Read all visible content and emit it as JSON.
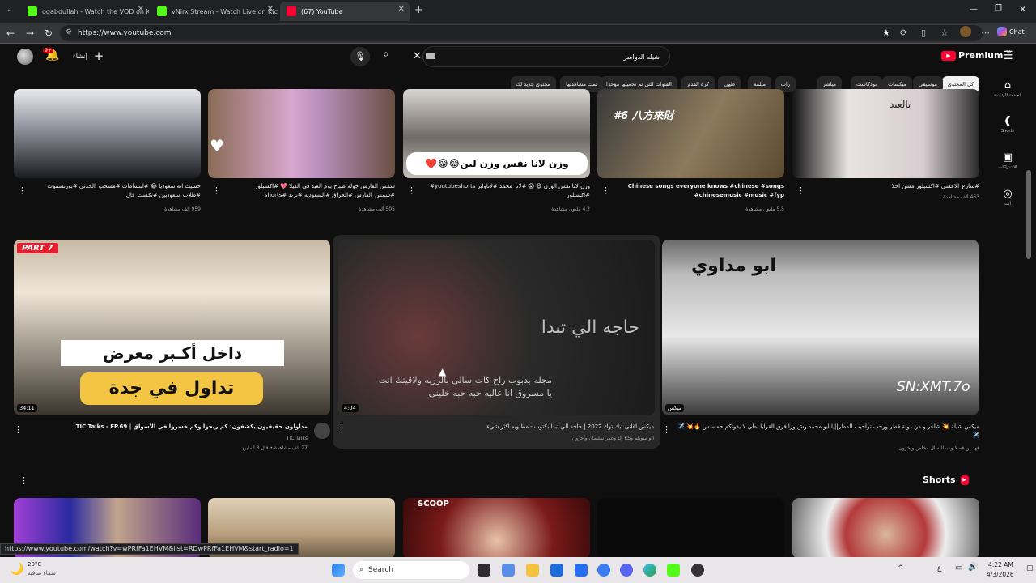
{
  "browser": {
    "tabs": [
      {
        "title": "ogabdullah - Watch the VOD on K"
      },
      {
        "title": "vNirx Stream - Watch Live on Kick"
      },
      {
        "title": "(67) YouTube"
      }
    ],
    "url": "https://www.youtube.com",
    "chat_label": "Chat"
  },
  "yt": {
    "logo_text": "Premium",
    "logo_region": "SA",
    "search_value": "شيله الدواسر",
    "notif_count": "9+",
    "create_label": "إنشاء",
    "chips": [
      "كل المحتوى",
      "موسيقى",
      "ميكسات",
      "بودكاست",
      "مباشر",
      "راب",
      "ميلمة",
      "طهي",
      "كرة القدم",
      "القنوات التي تم تحميلها مؤخرًا",
      "تمت مشاهدتها",
      "محتوى جديد لك"
    ],
    "rail": [
      "الصفحة الرئيسية",
      "Shorts",
      "الاشتراكات",
      "أنت"
    ]
  },
  "row1": [
    {
      "title": "حسيت انه سعوديا 😂 #ابتسامات #مسحب_الحدثي #بورتسموث #طلاب_سعوديين #تكست_قال",
      "meta": "959 ألف مشاهدة"
    },
    {
      "title": "شمس القارس جولة صباح يوم العيد في الفيلا 💖 #اكسبلور #شمس_القارس #الحراق #السعودية #ترند #shorts",
      "meta": "505 ألف مشاهدة"
    },
    {
      "title": "وزن لانا نفس الوزن 😅 😱 #لانا_محمد #لاناوايز youtubeshorts# #اكسبلور",
      "meta": "4.2 مليون مشاهدة",
      "caption": "وزن لانا نفس وزن لين😂😂❤️"
    },
    {
      "title": "Chinese songs everyone knows #chinese #songs #chinesemusic #music #fyp",
      "meta": "5.5 مليون مشاهدة",
      "badge": "#6 八方來財"
    },
    {
      "title": "#شارع_الاعشى #اكسبلور مسن احلا",
      "meta": "463 ألف مشاهدة",
      "caption": "بالعيد"
    }
  ],
  "row2": [
    {
      "title": "مداولون حقيقيون يكشفون: كم ربحوا وكم خسروا في الأسواق | TIC Talks - EP.69",
      "channel": "TIC Talks",
      "meta": "27 ألف مشاهدة • قبل 3 أسابيع",
      "duration": "34:11",
      "badge": "PART 7",
      "overlay1": "داخل أكـبر معرض",
      "overlay2": "تداول في جدة"
    },
    {
      "title": "ميكس اغاني تيك توك 2022 | حاجه الي تبدا بكتوب - مطلوبه اكثر شيء",
      "channel": "ابو سويلم وDj KS وعمر سليمان وآخرون",
      "meta": "",
      "duration": "4:04",
      "overlay1": "حاجه الي تبدا",
      "overlay2": "مجله بدبوب راح كات سالي بالزربه ولاقيتك انت يا مسروق انا غاليه حبه حبه خليني"
    },
    {
      "title": "ميكس شيلة 💥 شاعر و من دولة قطر ورحب تراحيب المطر||يا ابو محمد وش ورا فرق القرايا بطي لا يفوتكم حماسس 🔥💥 ✈️✈️",
      "channel": "فهد بن فصلا وعبدالله ال مخلص وآخرون",
      "meta": "",
      "duration": "ميكس",
      "overlay1": "ابو مداوي",
      "overlay2": "SN:XMT.7o"
    }
  ],
  "shorts": {
    "label": "Shorts",
    "scoop": "SCOOP"
  },
  "status_url": "https://www.youtube.com/watch?v=wPRfFa1EHVM&list=RDwPRfFa1EHVM&start_radio=1",
  "taskbar": {
    "weather_temp": "20°C",
    "weather_desc": "سماء صافية",
    "search": "Search",
    "time": "4:22 AM",
    "date": "4/3/2026",
    "lang": "ع"
  },
  "colors": {
    "yt_red": "#ff0033",
    "kick_green": "#53fc18",
    "bg": "#0f0f0f"
  }
}
